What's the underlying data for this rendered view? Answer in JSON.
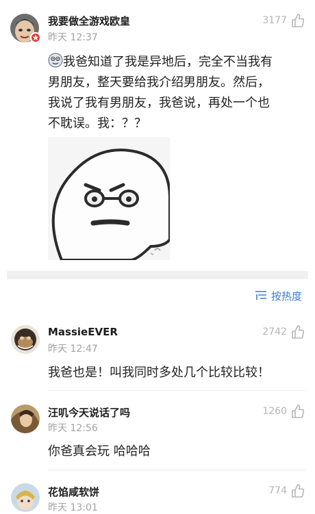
{
  "main_comment": {
    "username": "我要做全游戏欧皇",
    "time": "昨天 12:37",
    "likes": "3177",
    "text": "我爸知道了我是异地后，完全不当我有男朋友，整天要给我介绍男朋友。然后，我说了我有男朋友，我爸说，再处一个也不耽误。我：？？",
    "lines": [
      "我爸知道了我是异地后，完全不当我有",
      "男朋友，整天要给我介绍男朋友。然后，",
      "我说了我有男朋友，我爸说，再处一个也",
      "不耽误。我：？？"
    ]
  },
  "sort": {
    "label": "按热度"
  },
  "replies": [
    {
      "username": "MassieEVER",
      "time": "昨天 12:47",
      "likes": "2742",
      "text": "我爸也是！叫我同时多处几个比较比较！"
    },
    {
      "username": "汪叽今天说话了吗",
      "time": "昨天 12:56",
      "likes": "1260",
      "text": "你爸真会玩 哈哈哈"
    },
    {
      "username": "花馅咸软饼",
      "time": "昨天 13:01",
      "likes": "774",
      "text": ""
    }
  ],
  "colors": {
    "accent": "#3d7bd1",
    "badge": "#e53935"
  }
}
